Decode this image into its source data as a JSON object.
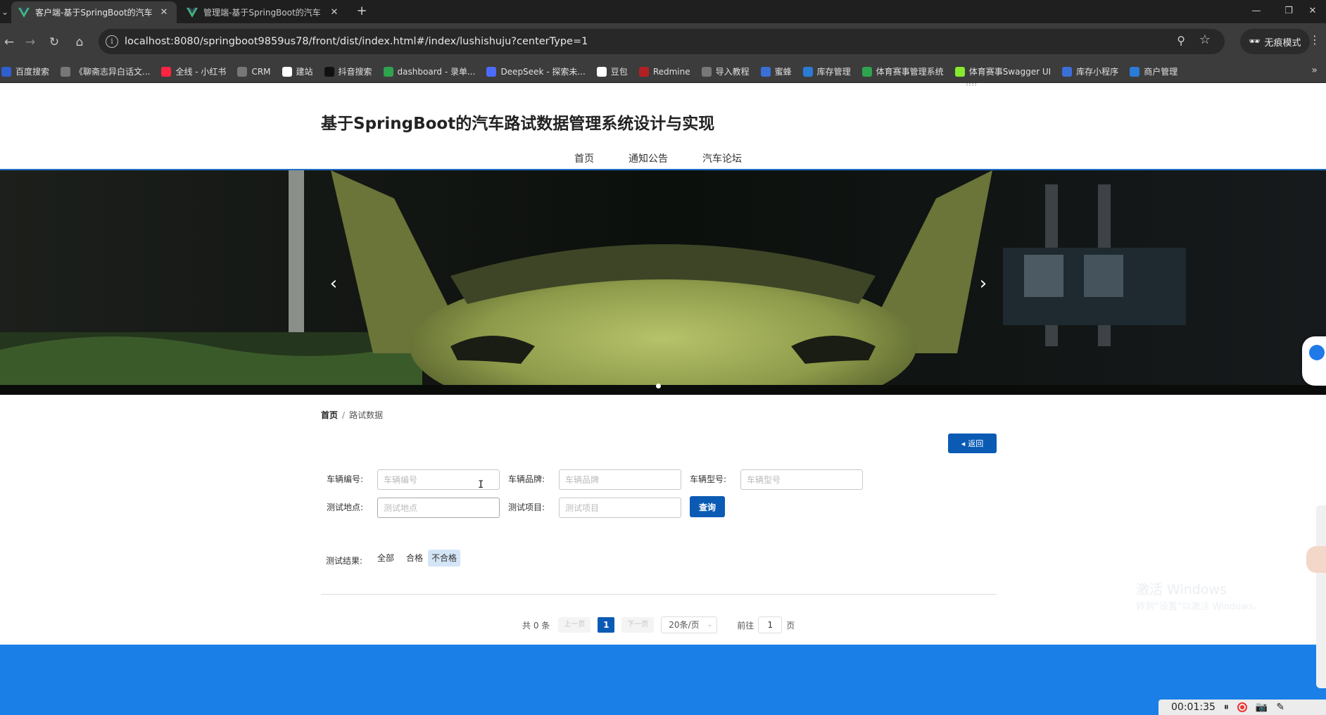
{
  "browser": {
    "tabs": [
      {
        "title": "客户端-基于SpringBoot的汽车",
        "active": true
      },
      {
        "title": "管理端-基于SpringBoot的汽车",
        "active": false
      }
    ],
    "url": "localhost:8080/springboot9859us78/front/dist/index.html#/index/lushishuju?centerType=1",
    "incognito_label": "无痕模式",
    "bookmarks": [
      {
        "label": "百度搜索",
        "icon": "baidu-icon",
        "color": "#2f5fd0"
      },
      {
        "label": "《聊斋志异白话文...",
        "icon": "globe-icon",
        "color": "#777777"
      },
      {
        "label": "全线 - 小红书",
        "icon": "xiaohongshu-icon",
        "color": "#ff2442"
      },
      {
        "label": "CRM",
        "icon": "globe-icon",
        "color": "#777777"
      },
      {
        "label": "建站",
        "icon": "site-icon",
        "color": "#ffffff"
      },
      {
        "label": "抖音搜索",
        "icon": "douyin-icon",
        "color": "#111111"
      },
      {
        "label": "dashboard - 录单...",
        "icon": "dashboard-icon",
        "color": "#2ea44f"
      },
      {
        "label": "DeepSeek - 探索未...",
        "icon": "deepseek-icon",
        "color": "#4d6bfe"
      },
      {
        "label": "豆包",
        "icon": "doubao-icon",
        "color": "#ffffff"
      },
      {
        "label": "Redmine",
        "icon": "redmine-icon",
        "color": "#b32024"
      },
      {
        "label": "导入教程",
        "icon": "globe-icon",
        "color": "#777777"
      },
      {
        "label": "蜜蜂",
        "icon": "bee-icon",
        "color": "#3a6fd8"
      },
      {
        "label": "库存管理",
        "icon": "inventory-icon",
        "color": "#2a7bd6"
      },
      {
        "label": "体育赛事管理系统",
        "icon": "sports-icon",
        "color": "#2ea44f"
      },
      {
        "label": "体育赛事Swagger UI",
        "icon": "swagger-icon",
        "color": "#85ea2d"
      },
      {
        "label": "库存小程序",
        "icon": "mini-program-icon",
        "color": "#3a6fd8"
      },
      {
        "label": "商户管理",
        "icon": "merchant-icon",
        "color": "#2a7bd6"
      }
    ]
  },
  "site": {
    "top_tiny": "!!!!",
    "title": "基于SpringBoot的汽车路试数据管理系统设计与实现",
    "nav": [
      "首页",
      "通知公告",
      "汽车论坛"
    ]
  },
  "breadcrumb": {
    "home": "首页",
    "sep": "/",
    "current": "路试数据"
  },
  "back_button": "返回",
  "filters": {
    "vehicle_no": {
      "label": "车辆编号:",
      "placeholder": "车辆编号",
      "value": ""
    },
    "brand": {
      "label": "车辆品牌:",
      "placeholder": "车辆品牌",
      "value": ""
    },
    "model": {
      "label": "车辆型号:",
      "placeholder": "车辆型号",
      "value": ""
    },
    "location": {
      "label": "测试地点:",
      "placeholder": "测试地点",
      "value": ""
    },
    "item": {
      "label": "测试项目:",
      "placeholder": "测试项目",
      "value": ""
    },
    "query_button": "查询"
  },
  "result_filter": {
    "label": "测试结果:",
    "options": [
      "全部",
      "合格",
      "不合格"
    ],
    "selected": "不合格"
  },
  "pagination": {
    "total": "共 0 条",
    "prev": "上一页",
    "current_page": "1",
    "next": "下一页",
    "page_size": "20条/页",
    "goto_label": "前往",
    "goto_value": "1",
    "goto_suffix": "页"
  },
  "overlay": {
    "activate_title": "激活 Windows",
    "activate_sub": "转到“设置”以激活 Windows。",
    "timer": "00:01:35"
  },
  "colors": {
    "primary": "#0b5bb5",
    "footer": "#1a7fe6",
    "selected_chip": "#d4e5f7"
  }
}
